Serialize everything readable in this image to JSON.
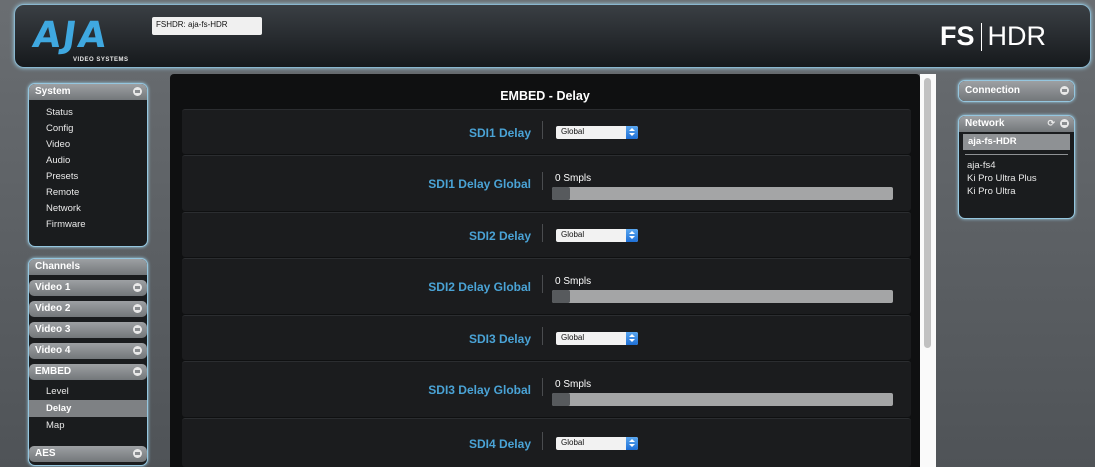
{
  "header": {
    "logo_text": "AJA",
    "logo_subtext": "VIDEO SYSTEMS",
    "device_tag": "FSHDR: aja-fs-HDR",
    "brand_fs": "FS",
    "brand_hdr": "HDR"
  },
  "system_panel": {
    "title": "System",
    "items": [
      "Status",
      "Config",
      "Video",
      "Audio",
      "Presets",
      "Remote",
      "Network",
      "Firmware"
    ]
  },
  "channels_panel": {
    "title": "Channels",
    "groups": [
      "Video 1",
      "Video 2",
      "Video 3",
      "Video 4",
      "EMBED",
      "AES"
    ],
    "embed_items": [
      "Level",
      "Delay",
      "Map"
    ],
    "active_item": "Delay"
  },
  "main": {
    "title": "EMBED - Delay",
    "rows": [
      {
        "label": "SDI1 Delay",
        "type": "select",
        "value": "Global"
      },
      {
        "label": "SDI1 Delay Global",
        "type": "slider",
        "value": "0 Smpls",
        "fraction": 0
      },
      {
        "label": "SDI2 Delay",
        "type": "select",
        "value": "Global"
      },
      {
        "label": "SDI2 Delay Global",
        "type": "slider",
        "value": "0 Smpls",
        "fraction": 0
      },
      {
        "label": "SDI3 Delay",
        "type": "select",
        "value": "Global"
      },
      {
        "label": "SDI3 Delay Global",
        "type": "slider",
        "value": "0 Smpls",
        "fraction": 0
      },
      {
        "label": "SDI4 Delay",
        "type": "select",
        "value": "Global"
      }
    ]
  },
  "connection_panel": {
    "title": "Connection"
  },
  "network_panel": {
    "title": "Network",
    "selected": "aja-fs-HDR",
    "items": [
      "aja-fs4",
      "Ki Pro Ultra Plus",
      "Ki Pro Ultra"
    ]
  },
  "colors": {
    "accent_blue": "#4aa3d6",
    "panel_border": "#95c6df",
    "content_bg": "#0f1011"
  },
  "icons": [
    "gear-icon",
    "refresh-icon",
    "select-arrows-icon"
  ]
}
